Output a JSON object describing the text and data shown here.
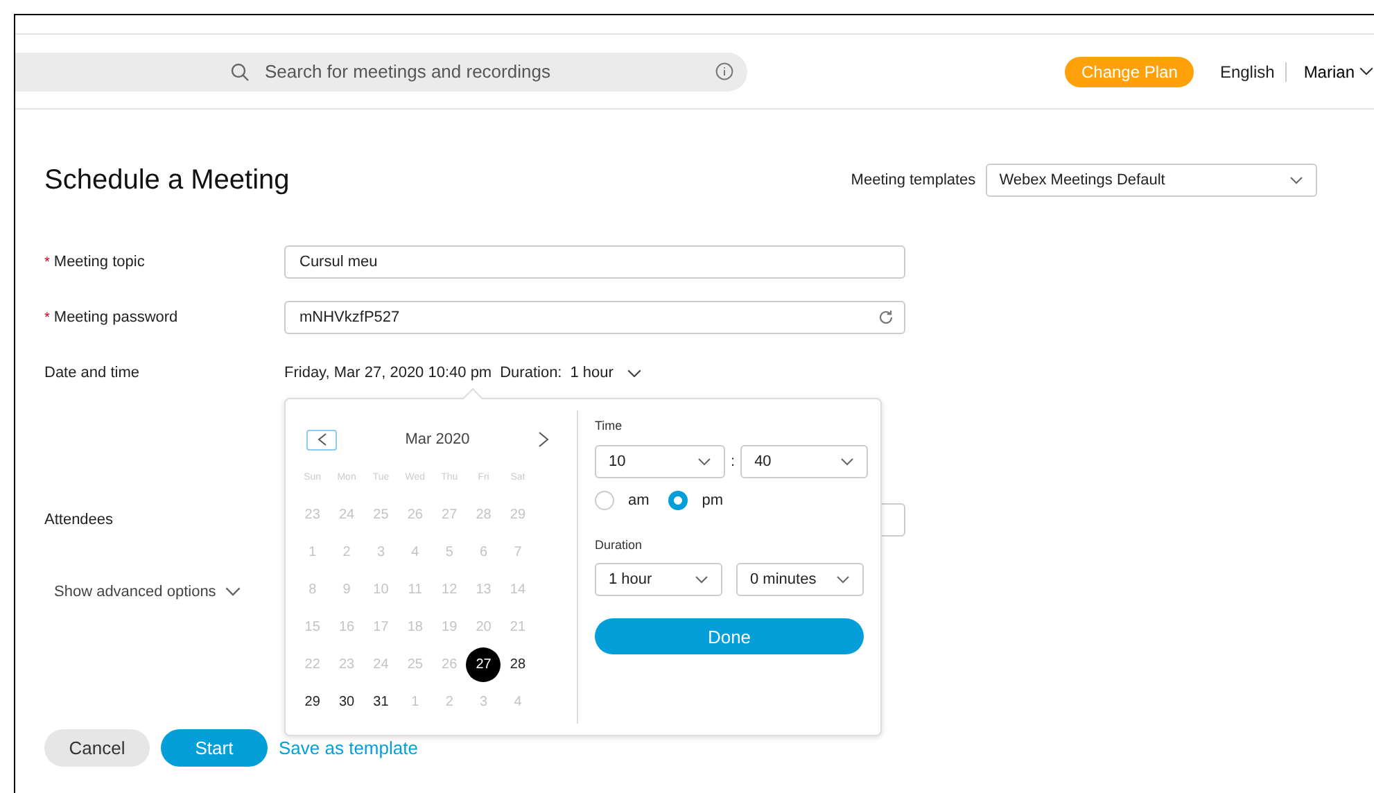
{
  "header": {
    "search_placeholder": "Search for meetings and recordings",
    "change_plan": "Change Plan",
    "language": "English",
    "user": "Marian"
  },
  "page": {
    "title": "Schedule a Meeting",
    "templates": {
      "label": "Meeting templates",
      "value": "Webex Meetings Default"
    }
  },
  "required_mark": "*",
  "fields": [
    {
      "label": "Meeting topic",
      "required": true,
      "value": "Cursul meu",
      "kind": "text"
    },
    {
      "label": "Meeting password",
      "required": true,
      "value": "mNHVkzfP527",
      "kind": "refresh"
    }
  ],
  "date_time": {
    "label": "Date and time",
    "value": "Friday, Mar 27, 2020 10:40 pm",
    "duration_label": "Duration:",
    "duration_value": "1 hour"
  },
  "attendees": {
    "label": "Attendees"
  },
  "advanced": {
    "label": "Show advanced options"
  },
  "buttons": {
    "cancel": "Cancel",
    "start": "Start",
    "save_template": "Save as template"
  },
  "picker": {
    "month": "Mar 2020",
    "weekdays": [
      "Sun",
      "Mon",
      "Tue",
      "Wed",
      "Thu",
      "Fri",
      "Sat"
    ],
    "weeks": [
      [
        {
          "day": "23",
          "disabled": true,
          "selected": false
        },
        {
          "day": "24",
          "disabled": true,
          "selected": false
        },
        {
          "day": "25",
          "disabled": true,
          "selected": false
        },
        {
          "day": "26",
          "disabled": true,
          "selected": false
        },
        {
          "day": "27",
          "disabled": true,
          "selected": false
        },
        {
          "day": "28",
          "disabled": true,
          "selected": false
        },
        {
          "day": "29",
          "disabled": true,
          "selected": false
        }
      ],
      [
        {
          "day": "1",
          "disabled": true,
          "selected": false
        },
        {
          "day": "2",
          "disabled": true,
          "selected": false
        },
        {
          "day": "3",
          "disabled": true,
          "selected": false
        },
        {
          "day": "4",
          "disabled": true,
          "selected": false
        },
        {
          "day": "5",
          "disabled": true,
          "selected": false
        },
        {
          "day": "6",
          "disabled": true,
          "selected": false
        },
        {
          "day": "7",
          "disabled": true,
          "selected": false
        }
      ],
      [
        {
          "day": "8",
          "disabled": true,
          "selected": false
        },
        {
          "day": "9",
          "disabled": true,
          "selected": false
        },
        {
          "day": "10",
          "disabled": true,
          "selected": false
        },
        {
          "day": "11",
          "disabled": true,
          "selected": false
        },
        {
          "day": "12",
          "disabled": true,
          "selected": false
        },
        {
          "day": "13",
          "disabled": true,
          "selected": false
        },
        {
          "day": "14",
          "disabled": true,
          "selected": false
        }
      ],
      [
        {
          "day": "15",
          "disabled": true,
          "selected": false
        },
        {
          "day": "16",
          "disabled": true,
          "selected": false
        },
        {
          "day": "17",
          "disabled": true,
          "selected": false
        },
        {
          "day": "18",
          "disabled": true,
          "selected": false
        },
        {
          "day": "19",
          "disabled": true,
          "selected": false
        },
        {
          "day": "20",
          "disabled": true,
          "selected": false
        },
        {
          "day": "21",
          "disabled": true,
          "selected": false
        }
      ],
      [
        {
          "day": "22",
          "disabled": true,
          "selected": false
        },
        {
          "day": "23",
          "disabled": true,
          "selected": false
        },
        {
          "day": "24",
          "disabled": true,
          "selected": false
        },
        {
          "day": "25",
          "disabled": true,
          "selected": false
        },
        {
          "day": "26",
          "disabled": true,
          "selected": false
        },
        {
          "day": "27",
          "disabled": false,
          "selected": true
        },
        {
          "day": "28",
          "disabled": false,
          "selected": false
        }
      ],
      [
        {
          "day": "29",
          "disabled": false,
          "selected": false
        },
        {
          "day": "30",
          "disabled": false,
          "selected": false
        },
        {
          "day": "31",
          "disabled": false,
          "selected": false
        },
        {
          "day": "1",
          "disabled": true,
          "selected": false
        },
        {
          "day": "2",
          "disabled": true,
          "selected": false
        },
        {
          "day": "3",
          "disabled": true,
          "selected": false
        },
        {
          "day": "4",
          "disabled": true,
          "selected": false
        }
      ]
    ],
    "time_label": "Time",
    "hour": "10",
    "separator": ":",
    "minute": "40",
    "meridiem": [
      {
        "label": "am",
        "selected": false
      },
      {
        "label": "pm",
        "selected": true
      }
    ],
    "duration_label": "Duration",
    "duration_hours": "1 hour",
    "duration_minutes": "0 minutes",
    "done": "Done"
  }
}
